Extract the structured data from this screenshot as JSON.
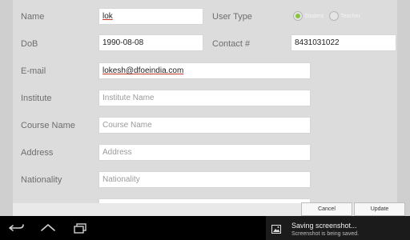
{
  "form": {
    "name": {
      "label": "Name",
      "value": "lok"
    },
    "user_type": {
      "label": "User Type",
      "options": [
        "Student",
        "Teacher"
      ],
      "selected": "Student"
    },
    "dob": {
      "label": "DoB",
      "value": "1990-08-08"
    },
    "contact": {
      "label": "Contact #",
      "value": "8431031022"
    },
    "email": {
      "label": "E-mail",
      "value": "lokesh@dfoeindia.com"
    },
    "institute": {
      "label": "Institute",
      "placeholder": "Institute Name"
    },
    "course": {
      "label": "Course Name",
      "placeholder": "Course Name"
    },
    "address": {
      "label": "Address",
      "placeholder": "Address"
    },
    "nationality": {
      "label": "Nationality",
      "placeholder": "Nationality"
    }
  },
  "buttons": {
    "cancel": "Cancel",
    "update": "Update"
  },
  "notification": {
    "title": "Saving screenshot...",
    "subtitle": "Screenshot is being saved."
  },
  "navbar": {
    "icons": [
      "back-icon",
      "home-icon",
      "recent-apps-icon"
    ]
  },
  "colors": {
    "radio_selected": "#8ac53e",
    "underline": "#c0392b",
    "navbar": "#000000"
  }
}
